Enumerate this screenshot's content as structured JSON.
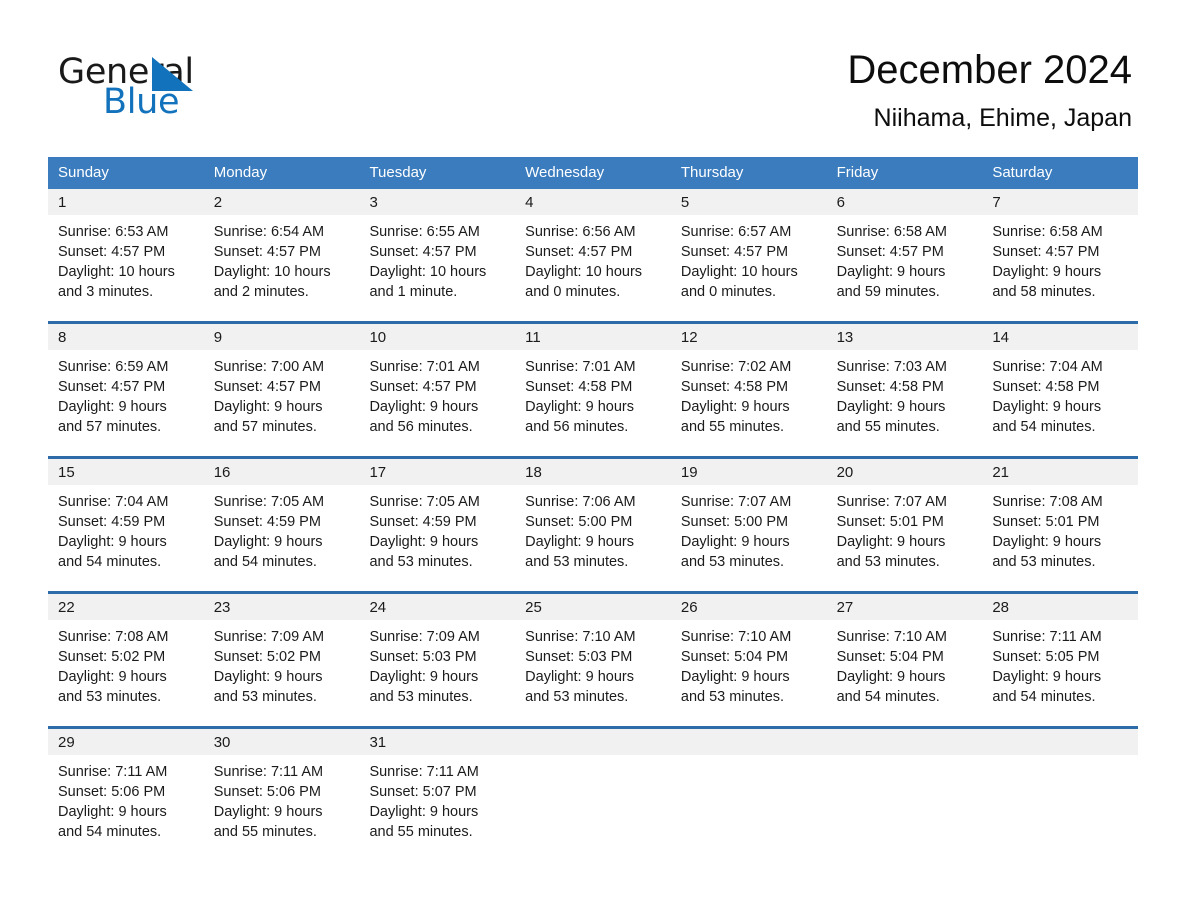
{
  "brand": {
    "name_part1": "General",
    "name_part2": "Blue",
    "accent_color": "#1272bc"
  },
  "header": {
    "month_title": "December 2024",
    "location": "Niihama, Ehime, Japan"
  },
  "colors": {
    "header_blue": "#3a7cbe",
    "separator_blue": "#2d6ca8",
    "daynum_band": "#f1f1f1",
    "text": "#1b1b1b"
  },
  "calendar": {
    "day_headers": [
      "Sunday",
      "Monday",
      "Tuesday",
      "Wednesday",
      "Thursday",
      "Friday",
      "Saturday"
    ],
    "weeks": [
      [
        {
          "day": "1",
          "sunrise": "Sunrise: 6:53 AM",
          "sunset": "Sunset: 4:57 PM",
          "daylight1": "Daylight: 10 hours",
          "daylight2": "and 3 minutes."
        },
        {
          "day": "2",
          "sunrise": "Sunrise: 6:54 AM",
          "sunset": "Sunset: 4:57 PM",
          "daylight1": "Daylight: 10 hours",
          "daylight2": "and 2 minutes."
        },
        {
          "day": "3",
          "sunrise": "Sunrise: 6:55 AM",
          "sunset": "Sunset: 4:57 PM",
          "daylight1": "Daylight: 10 hours",
          "daylight2": "and 1 minute."
        },
        {
          "day": "4",
          "sunrise": "Sunrise: 6:56 AM",
          "sunset": "Sunset: 4:57 PM",
          "daylight1": "Daylight: 10 hours",
          "daylight2": "and 0 minutes."
        },
        {
          "day": "5",
          "sunrise": "Sunrise: 6:57 AM",
          "sunset": "Sunset: 4:57 PM",
          "daylight1": "Daylight: 10 hours",
          "daylight2": "and 0 minutes."
        },
        {
          "day": "6",
          "sunrise": "Sunrise: 6:58 AM",
          "sunset": "Sunset: 4:57 PM",
          "daylight1": "Daylight: 9 hours",
          "daylight2": "and 59 minutes."
        },
        {
          "day": "7",
          "sunrise": "Sunrise: 6:58 AM",
          "sunset": "Sunset: 4:57 PM",
          "daylight1": "Daylight: 9 hours",
          "daylight2": "and 58 minutes."
        }
      ],
      [
        {
          "day": "8",
          "sunrise": "Sunrise: 6:59 AM",
          "sunset": "Sunset: 4:57 PM",
          "daylight1": "Daylight: 9 hours",
          "daylight2": "and 57 minutes."
        },
        {
          "day": "9",
          "sunrise": "Sunrise: 7:00 AM",
          "sunset": "Sunset: 4:57 PM",
          "daylight1": "Daylight: 9 hours",
          "daylight2": "and 57 minutes."
        },
        {
          "day": "10",
          "sunrise": "Sunrise: 7:01 AM",
          "sunset": "Sunset: 4:57 PM",
          "daylight1": "Daylight: 9 hours",
          "daylight2": "and 56 minutes."
        },
        {
          "day": "11",
          "sunrise": "Sunrise: 7:01 AM",
          "sunset": "Sunset: 4:58 PM",
          "daylight1": "Daylight: 9 hours",
          "daylight2": "and 56 minutes."
        },
        {
          "day": "12",
          "sunrise": "Sunrise: 7:02 AM",
          "sunset": "Sunset: 4:58 PM",
          "daylight1": "Daylight: 9 hours",
          "daylight2": "and 55 minutes."
        },
        {
          "day": "13",
          "sunrise": "Sunrise: 7:03 AM",
          "sunset": "Sunset: 4:58 PM",
          "daylight1": "Daylight: 9 hours",
          "daylight2": "and 55 minutes."
        },
        {
          "day": "14",
          "sunrise": "Sunrise: 7:04 AM",
          "sunset": "Sunset: 4:58 PM",
          "daylight1": "Daylight: 9 hours",
          "daylight2": "and 54 minutes."
        }
      ],
      [
        {
          "day": "15",
          "sunrise": "Sunrise: 7:04 AM",
          "sunset": "Sunset: 4:59 PM",
          "daylight1": "Daylight: 9 hours",
          "daylight2": "and 54 minutes."
        },
        {
          "day": "16",
          "sunrise": "Sunrise: 7:05 AM",
          "sunset": "Sunset: 4:59 PM",
          "daylight1": "Daylight: 9 hours",
          "daylight2": "and 54 minutes."
        },
        {
          "day": "17",
          "sunrise": "Sunrise: 7:05 AM",
          "sunset": "Sunset: 4:59 PM",
          "daylight1": "Daylight: 9 hours",
          "daylight2": "and 53 minutes."
        },
        {
          "day": "18",
          "sunrise": "Sunrise: 7:06 AM",
          "sunset": "Sunset: 5:00 PM",
          "daylight1": "Daylight: 9 hours",
          "daylight2": "and 53 minutes."
        },
        {
          "day": "19",
          "sunrise": "Sunrise: 7:07 AM",
          "sunset": "Sunset: 5:00 PM",
          "daylight1": "Daylight: 9 hours",
          "daylight2": "and 53 minutes."
        },
        {
          "day": "20",
          "sunrise": "Sunrise: 7:07 AM",
          "sunset": "Sunset: 5:01 PM",
          "daylight1": "Daylight: 9 hours",
          "daylight2": "and 53 minutes."
        },
        {
          "day": "21",
          "sunrise": "Sunrise: 7:08 AM",
          "sunset": "Sunset: 5:01 PM",
          "daylight1": "Daylight: 9 hours",
          "daylight2": "and 53 minutes."
        }
      ],
      [
        {
          "day": "22",
          "sunrise": "Sunrise: 7:08 AM",
          "sunset": "Sunset: 5:02 PM",
          "daylight1": "Daylight: 9 hours",
          "daylight2": "and 53 minutes."
        },
        {
          "day": "23",
          "sunrise": "Sunrise: 7:09 AM",
          "sunset": "Sunset: 5:02 PM",
          "daylight1": "Daylight: 9 hours",
          "daylight2": "and 53 minutes."
        },
        {
          "day": "24",
          "sunrise": "Sunrise: 7:09 AM",
          "sunset": "Sunset: 5:03 PM",
          "daylight1": "Daylight: 9 hours",
          "daylight2": "and 53 minutes."
        },
        {
          "day": "25",
          "sunrise": "Sunrise: 7:10 AM",
          "sunset": "Sunset: 5:03 PM",
          "daylight1": "Daylight: 9 hours",
          "daylight2": "and 53 minutes."
        },
        {
          "day": "26",
          "sunrise": "Sunrise: 7:10 AM",
          "sunset": "Sunset: 5:04 PM",
          "daylight1": "Daylight: 9 hours",
          "daylight2": "and 53 minutes."
        },
        {
          "day": "27",
          "sunrise": "Sunrise: 7:10 AM",
          "sunset": "Sunset: 5:04 PM",
          "daylight1": "Daylight: 9 hours",
          "daylight2": "and 54 minutes."
        },
        {
          "day": "28",
          "sunrise": "Sunrise: 7:11 AM",
          "sunset": "Sunset: 5:05 PM",
          "daylight1": "Daylight: 9 hours",
          "daylight2": "and 54 minutes."
        }
      ],
      [
        {
          "day": "29",
          "sunrise": "Sunrise: 7:11 AM",
          "sunset": "Sunset: 5:06 PM",
          "daylight1": "Daylight: 9 hours",
          "daylight2": "and 54 minutes."
        },
        {
          "day": "30",
          "sunrise": "Sunrise: 7:11 AM",
          "sunset": "Sunset: 5:06 PM",
          "daylight1": "Daylight: 9 hours",
          "daylight2": "and 55 minutes."
        },
        {
          "day": "31",
          "sunrise": "Sunrise: 7:11 AM",
          "sunset": "Sunset: 5:07 PM",
          "daylight1": "Daylight: 9 hours",
          "daylight2": "and 55 minutes."
        },
        {
          "day": "",
          "sunrise": "",
          "sunset": "",
          "daylight1": "",
          "daylight2": ""
        },
        {
          "day": "",
          "sunrise": "",
          "sunset": "",
          "daylight1": "",
          "daylight2": ""
        },
        {
          "day": "",
          "sunrise": "",
          "sunset": "",
          "daylight1": "",
          "daylight2": ""
        },
        {
          "day": "",
          "sunrise": "",
          "sunset": "",
          "daylight1": "",
          "daylight2": ""
        }
      ]
    ]
  }
}
